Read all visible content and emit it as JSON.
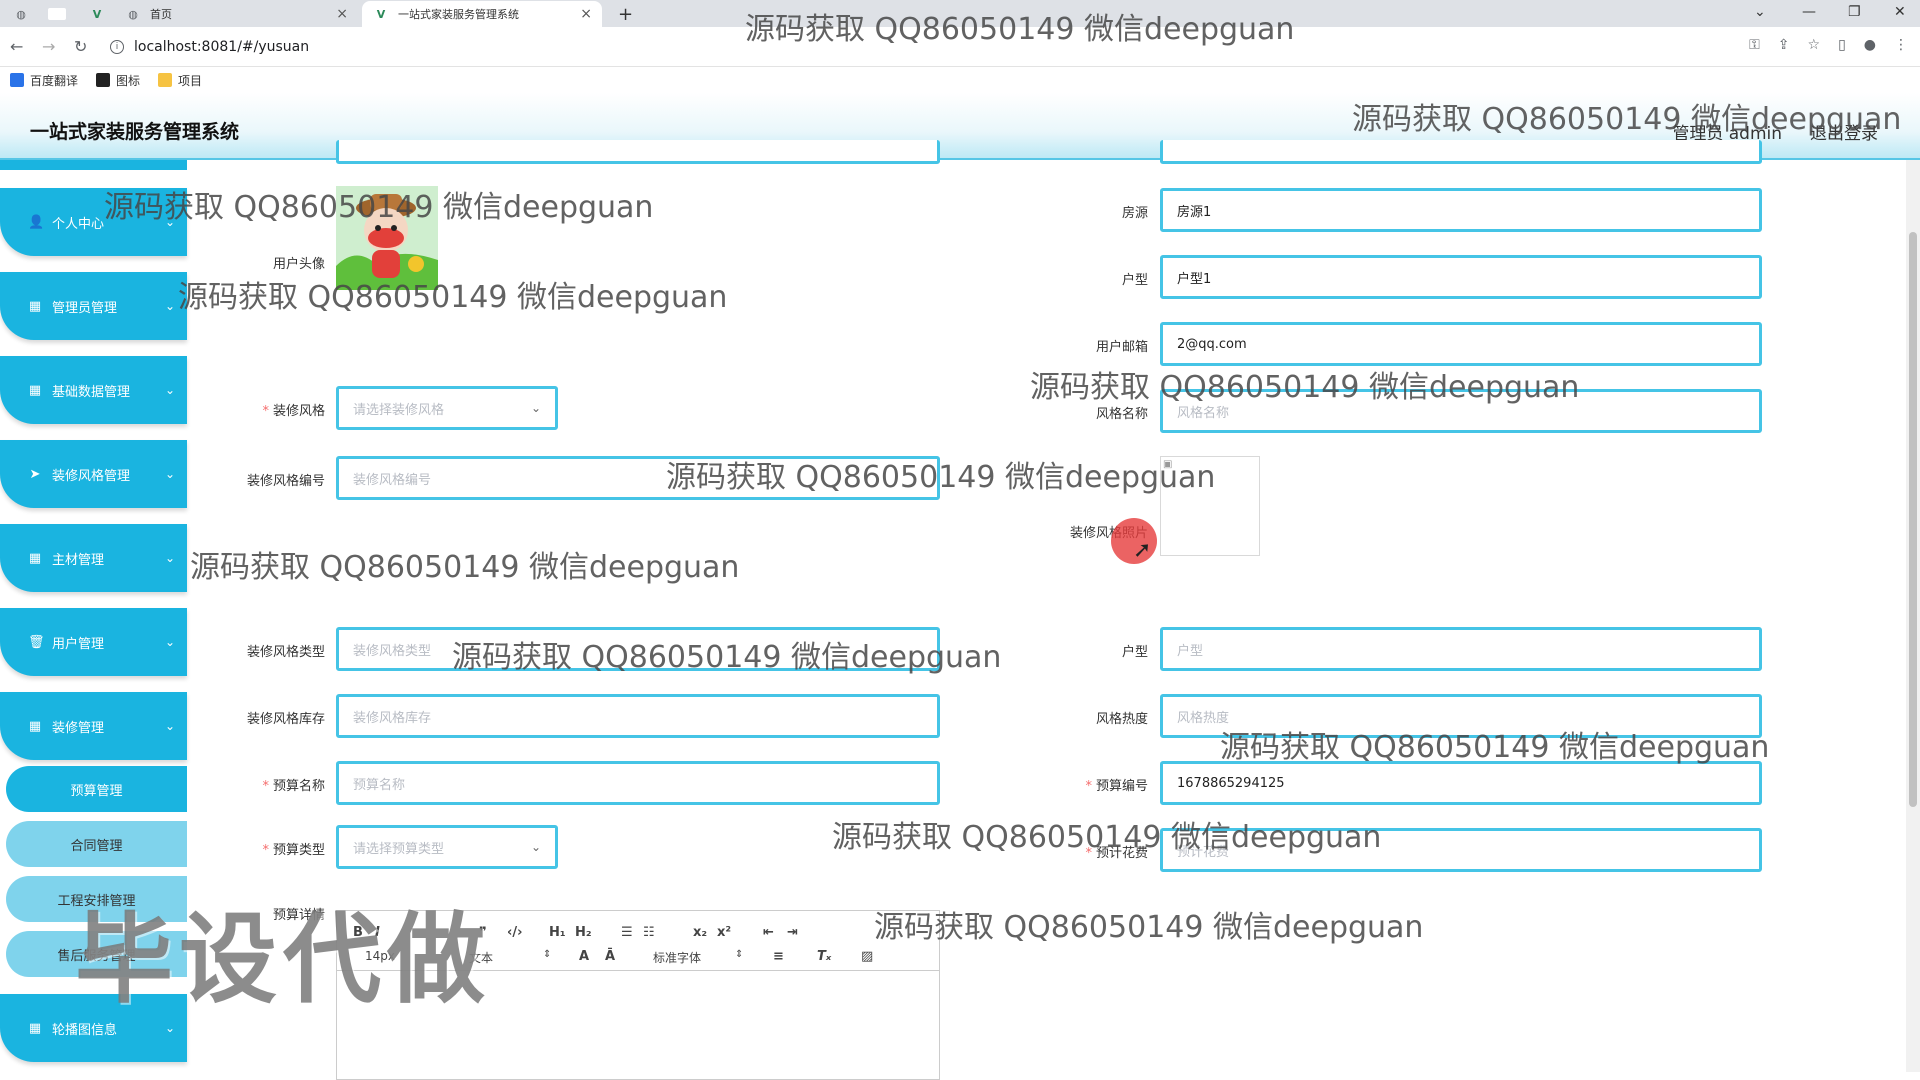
{
  "browser": {
    "tabs": [
      {
        "label": "首页",
        "icon": "globe-icon"
      },
      {
        "label": "一站式家装服务管理系统",
        "icon": "vue-icon"
      }
    ],
    "new_tab": "+",
    "url": "localhost:8081/#/yusuan",
    "bookmarks": [
      {
        "label": "百度翻译",
        "color": "#2a73e8"
      },
      {
        "label": "图标",
        "color": "#222222"
      },
      {
        "label": "项目",
        "color": "#f6c342"
      }
    ]
  },
  "header": {
    "title": "一站式家装服务管理系统",
    "user": "管理员 admin",
    "logout": "退出登录"
  },
  "sidebar": {
    "items": [
      {
        "label": "个人中心",
        "icon": "person-icon"
      },
      {
        "label": "管理员管理",
        "icon": "grid-icon"
      },
      {
        "label": "基础数据管理",
        "icon": "grid-icon"
      },
      {
        "label": "装修风格管理",
        "icon": "send-icon"
      },
      {
        "label": "主材管理",
        "icon": "grid-icon"
      },
      {
        "label": "用户管理",
        "icon": "trash-icon"
      },
      {
        "label": "装修管理",
        "icon": "grid-icon"
      }
    ],
    "sub_items": [
      "预算管理",
      "合同管理",
      "工程安排管理",
      "售后服务管理"
    ],
    "last_item": {
      "label": "轮播图信息",
      "icon": "grid-icon"
    }
  },
  "form": {
    "avatar_label": "用户头像",
    "fangyuan_label": "房源",
    "fangyuan_value": "房源1",
    "huxing_label": "户型",
    "huxing_value": "户型1",
    "email_label": "用户邮箱",
    "email_value": "2@qq.com",
    "style_label": "装修风格",
    "style_placeholder": "请选择装修风格",
    "style_name_label": "风格名称",
    "style_name_placeholder": "风格名称",
    "style_code_label": "装修风格编号",
    "style_code_placeholder": "装修风格编号",
    "style_photo_label": "装修风格照片",
    "style_type_label": "装修风格类型",
    "style_type_placeholder": "装修风格类型",
    "huxing2_label": "户型",
    "huxing2_placeholder": "户型",
    "stock_label": "装修风格库存",
    "stock_placeholder": "装修风格库存",
    "heat_label": "风格热度",
    "heat_placeholder": "风格热度",
    "budget_name_label": "预算名称",
    "budget_name_placeholder": "预算名称",
    "budget_code_label": "预算编号",
    "budget_code_value": "1678865294125",
    "budget_type_label": "预算类型",
    "budget_type_placeholder": "请选择预算类型",
    "cost_label": "预计花费",
    "cost_placeholder": "预计花费",
    "detail_label": "预算详情"
  },
  "editor": {
    "size_select": "14px",
    "para_select": "文本",
    "font_select": "标准字体"
  },
  "watermarks": {
    "text": "源码获取 QQ86050149 微信deepguan",
    "big": "毕设代做"
  }
}
